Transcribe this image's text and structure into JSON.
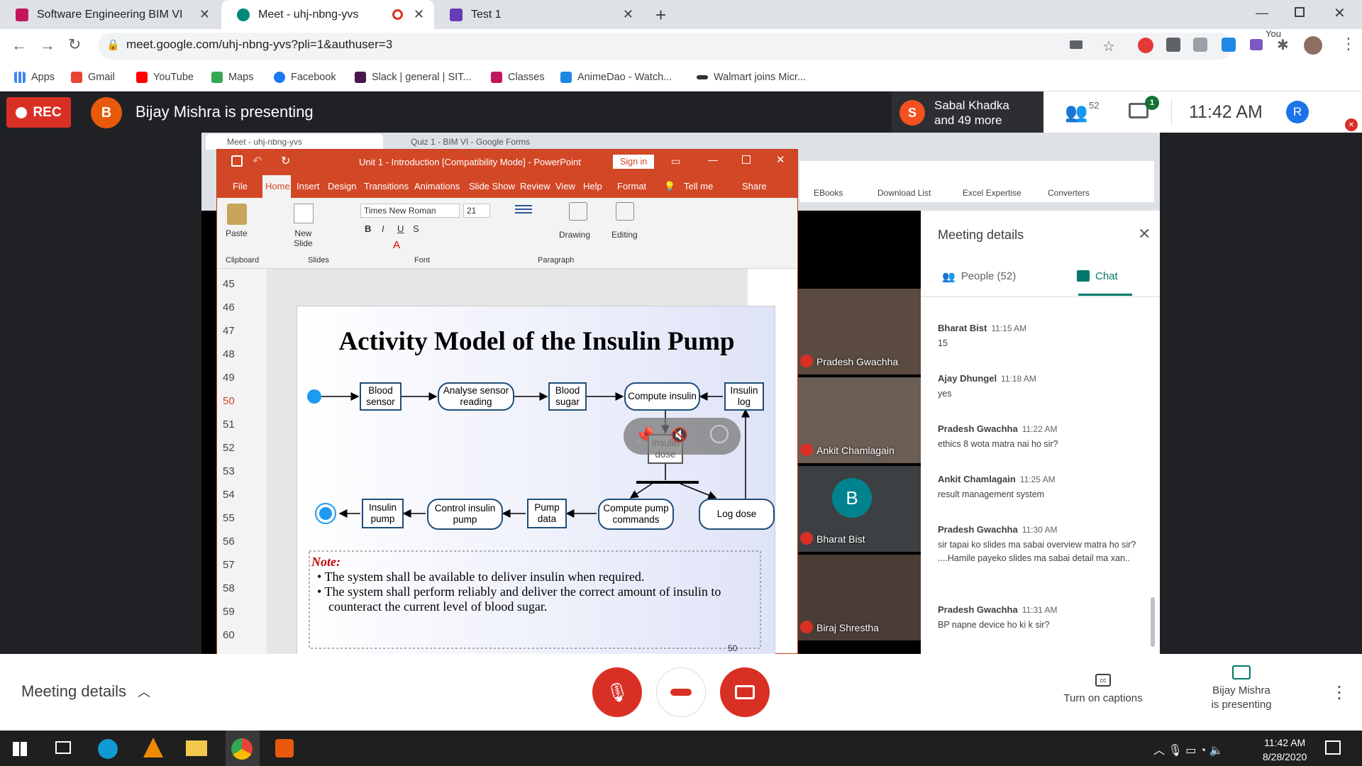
{
  "browser": {
    "tabs": [
      {
        "title": "Software Engineering BIM VI",
        "color": "#c2185b"
      },
      {
        "title": "Meet - uhj-nbng-yvs",
        "color": "#00897b"
      },
      {
        "title": "Test 1",
        "color": "#673ab7"
      }
    ],
    "url": "meet.google.com/uhj-nbng-yvs?pli=1&authuser=3",
    "bookmarks": [
      "Apps",
      "Gmail",
      "YouTube",
      "Maps",
      "Facebook",
      "Slack | general | SIT...",
      "Classes",
      "AnimeDao - Watch...",
      "Walmart joins Micr..."
    ]
  },
  "meet": {
    "rec_label": "REC",
    "presenter_initial": "B",
    "presenting_text": "Bijay Mishra is presenting",
    "participant_initial": "S",
    "participant_text_1": "Sabal Khadka",
    "participant_text_2": "and 49 more",
    "people_count": "52",
    "chat_badge": "1",
    "time": "11:42 AM",
    "you_label": "You",
    "you_initial": "R"
  },
  "inner_browser": {
    "tab1": "Meet - uhj-nbng-yvs",
    "tab2": "Quiz 1 - BIM VI - Google Forms",
    "bookmarks": [
      "EBooks",
      "Download List",
      "Excel Expertise",
      "Converters"
    ]
  },
  "powerpoint": {
    "title": "Unit 1 - Introduction [Compatibility Mode] - PowerPoint",
    "sign_in": "Sign in",
    "tabs": [
      "File",
      "Home",
      "Insert",
      "Design",
      "Transitions",
      "Animations",
      "Slide Show",
      "Review",
      "View",
      "Help",
      "Format"
    ],
    "tell_me": "Tell me",
    "share": "Share",
    "font": "Times New Roman",
    "font_size": "21",
    "groups": [
      "Clipboard",
      "Slides",
      "Font",
      "Paragraph"
    ],
    "paste": "Paste",
    "new_slide_1": "New",
    "new_slide_2": "Slide",
    "drawing": "Drawing",
    "editing": "Editing",
    "slide_numbers": [
      "45",
      "46",
      "47",
      "48",
      "49",
      "50",
      "51",
      "52",
      "53",
      "54",
      "55",
      "56",
      "57",
      "58",
      "59",
      "60"
    ],
    "active_slide": "50"
  },
  "slide": {
    "title": "Activity Model of the Insulin Pump",
    "nodes": {
      "blood_sensor": "Blood sensor",
      "analyse": "Analyse sensor reading",
      "blood_sugar": "Blood sugar",
      "compute_insulin": "Compute insulin",
      "insulin_log": "Insulin log",
      "insulin_dose": "Insulin dose",
      "log_dose": "Log dose",
      "compute_pump": "Compute pump commands",
      "pump_data": "Pump data",
      "control_pump": "Control insulin pump",
      "insulin_pump": "Insulin pump"
    },
    "note_label": "Note:",
    "note_1": "The system shall be available to deliver insulin when required.",
    "note_2": "The system shall perform reliably and deliver the correct amount of insulin to counteract the current level of blood sugar.",
    "page_number": "50"
  },
  "videos": [
    {
      "name": "Pradesh Gwachha",
      "bg": "#5a4a3f"
    },
    {
      "name": "Ankit Chamlagain",
      "bg": "#6b5e55"
    },
    {
      "name": "Bharat Bist",
      "bg": "#3c4043",
      "initial": "B"
    },
    {
      "name": "Biraj Shrestha",
      "bg": "#4a3d36"
    }
  ],
  "panel": {
    "title": "Meeting details",
    "people_tab": "People (52)",
    "chat_tab": "Chat",
    "messages": [
      {
        "name": "Bharat Bist",
        "time": "11:15 AM",
        "text": "15"
      },
      {
        "name": "Ajay Dhungel",
        "time": "11:18 AM",
        "text": "yes"
      },
      {
        "name": "Pradesh Gwachha",
        "time": "11:22 AM",
        "text": "ethics 8 wota matra nai ho sir?"
      },
      {
        "name": "Ankit Chamlagain",
        "time": "11:25 AM",
        "text": "result management system"
      },
      {
        "name": "Pradesh Gwachha",
        "time": "11:30 AM",
        "text": "sir tapai ko slides ma sabai overview matra ho sir? ....Hamile payeko slides ma sabai detail ma xan.."
      },
      {
        "name": "Pradesh Gwachha",
        "time": "11:31 AM",
        "text": "BP napne device ho ki k sir?"
      }
    ]
  },
  "bottom": {
    "meeting_details": "Meeting details",
    "captions": "Turn on captions",
    "presenting_1": "Bijay Mishra",
    "presenting_2": "is presenting"
  },
  "taskbar": {
    "time": "11:42 AM",
    "date": "8/28/2020"
  }
}
